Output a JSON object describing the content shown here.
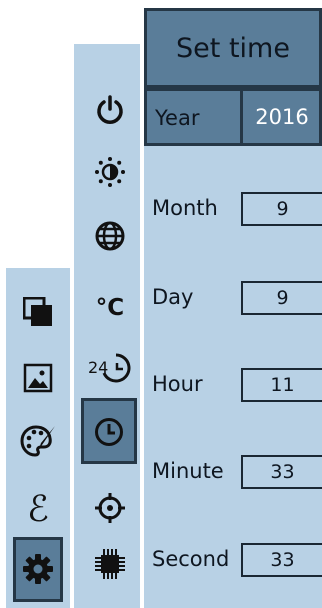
{
  "panel": {
    "title": "Set time",
    "year": {
      "label": "Year",
      "value": "2016"
    },
    "fields": [
      {
        "label": "Month",
        "value": "9"
      },
      {
        "label": "Day",
        "value": "9"
      },
      {
        "label": "Hour",
        "value": "11"
      },
      {
        "label": "Minute",
        "value": "33"
      },
      {
        "label": "Second",
        "value": "33"
      }
    ]
  },
  "sidebar_left": {
    "icons": [
      "layers-icon",
      "image-icon",
      "palette-icon",
      "epsilon-icon",
      "gear-icon"
    ],
    "selected": "gear-icon"
  },
  "sidebar_right": {
    "icons": [
      "power-icon",
      "brightness-icon",
      "globe-icon",
      "celsius-icon",
      "24h-icon",
      "clock-icon",
      "crosshair-icon",
      "chip-icon"
    ],
    "selected": "clock-icon",
    "temp_unit": "°C",
    "clock_24": "24"
  },
  "colors": {
    "panel_bg": "#b8d1e5",
    "selected_bg": "#5a7d99",
    "border": "#253746"
  }
}
